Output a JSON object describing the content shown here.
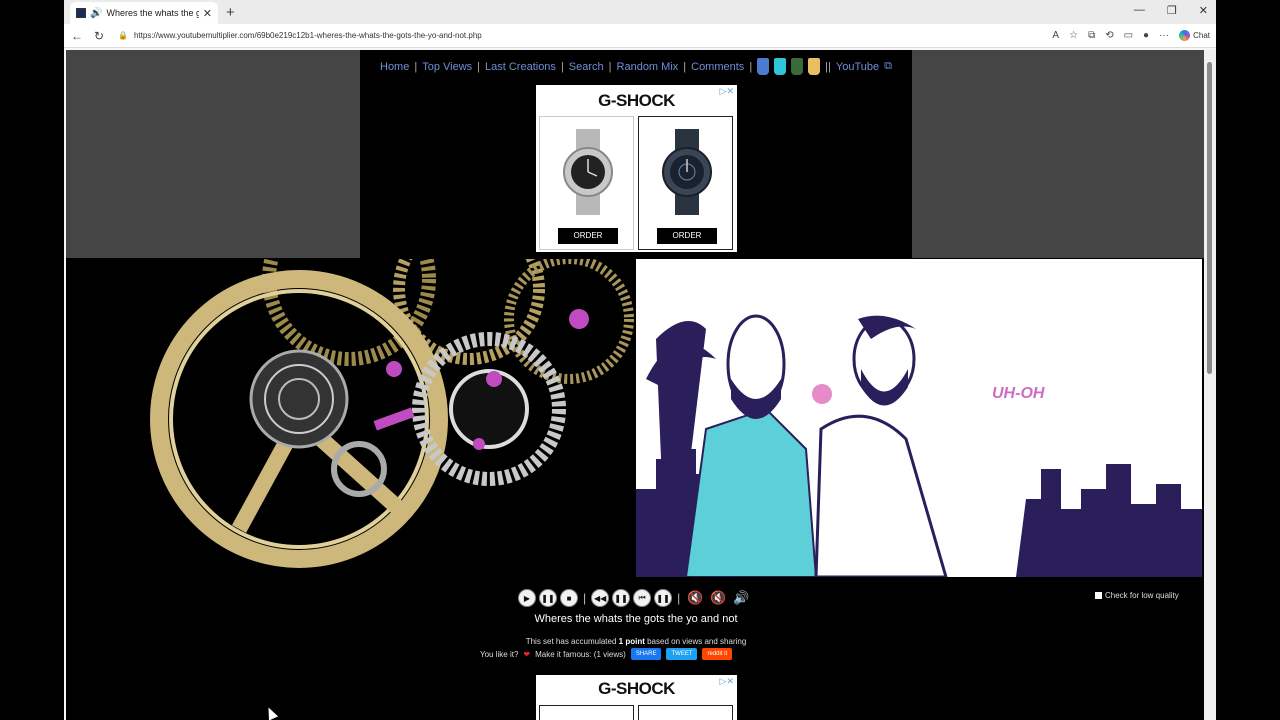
{
  "browser": {
    "tab_title": "Wheres the whats the gots the yo and not",
    "url": "https://www.youtubemultiplier.com/69b0e219c12b1-wheres-the-whats-the-gots-the-yo-and-not.php",
    "chat_label": "Chat"
  },
  "nav": {
    "home": "Home",
    "top_views": "Top Views",
    "last_creations": "Last Creations",
    "search": "Search",
    "random_mix": "Random Mix",
    "comments": "Comments",
    "youtube": "YouTube"
  },
  "ad": {
    "brand": "G-SHOCK",
    "order_1": "ORDER",
    "order_2": "ORDER"
  },
  "video_right": {
    "overlay_text": "UH-OH"
  },
  "player": {
    "low_quality_label": "Check for low quality"
  },
  "set": {
    "title": "Wheres the whats the gots the yo and not",
    "points_prefix": "This set has accumulated",
    "points_value": "1 point",
    "points_suffix": "based on views and sharing",
    "like_prompt": "You like it?",
    "famous_text": "Make it famous: (1 views)",
    "share_fb": "SHARE",
    "share_tw": "TWEET",
    "share_reddit": "reddit it"
  },
  "ad2": {
    "brand": "G-SHOCK"
  },
  "colors": {
    "nav_link": "#6f8fd8",
    "page_bg": "#000000",
    "side_gray": "#454545",
    "facebook": "#1877f2",
    "twitter": "#1da1f2",
    "reddit": "#ff4500"
  }
}
